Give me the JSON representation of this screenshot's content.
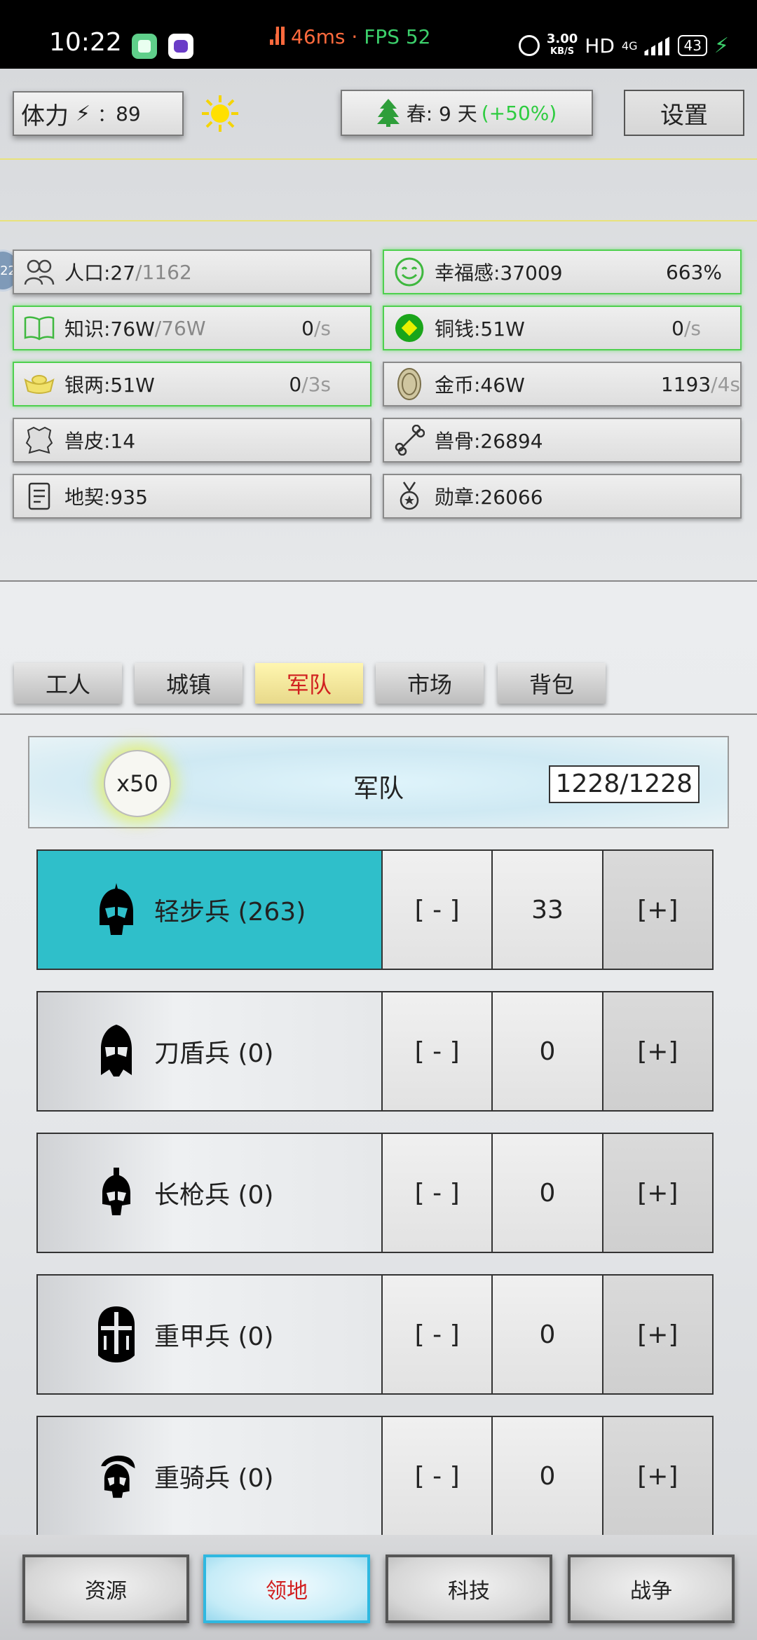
{
  "status_bar": {
    "time": "10:22",
    "ping": "46ms",
    "separator": " · ",
    "fps": "FPS 52",
    "speed_value": "3.00",
    "speed_unit": "KB/S",
    "hd": "HD",
    "network": "4G",
    "battery": "43"
  },
  "header": {
    "stamina_label": "体力",
    "stamina_sep": "：",
    "stamina_value": "89",
    "season_label": "春: 9 天",
    "season_bonus": "(+50%)",
    "settings_label": "设置"
  },
  "side_bubble": "22",
  "resources": {
    "population": {
      "label": "人口:27",
      "max": "/1162"
    },
    "happiness": {
      "label": "幸福感:37009",
      "percent": "663%"
    },
    "knowledge": {
      "label": "知识:76W",
      "max": "/76W",
      "rate": "0",
      "unit": "/s"
    },
    "copper": {
      "label": "铜钱:51W",
      "rate": "0",
      "unit": "/s"
    },
    "silver": {
      "label": "银两:51W",
      "rate": "0",
      "unit": "/3s"
    },
    "gold": {
      "label": "金币:46W",
      "rate": "1193",
      "unit": "/4s"
    },
    "pelt": {
      "label": "兽皮:14"
    },
    "bone": {
      "label": "兽骨:26894"
    },
    "deed": {
      "label": "地契:935"
    },
    "medal": {
      "label": "勋章:26066"
    }
  },
  "tabs": [
    "工人",
    "城镇",
    "军队",
    "市场",
    "背包"
  ],
  "active_tab": "军队",
  "army": {
    "multiplier": "x50",
    "title": "军队",
    "capacity": "1228/1228",
    "minus_label": "[ - ]",
    "plus_label": "[+]",
    "units": [
      {
        "name": "轻步兵 (263)",
        "value": "33"
      },
      {
        "name": "刀盾兵 (0)",
        "value": "0"
      },
      {
        "name": "长枪兵 (0)",
        "value": "0"
      },
      {
        "name": "重甲兵 (0)",
        "value": "0"
      },
      {
        "name": "重骑兵 (0)",
        "value": "0"
      }
    ]
  },
  "bottom_nav": [
    "资源",
    "领地",
    "科技",
    "战争"
  ],
  "colors": {
    "active_unit": "#2fbfca",
    "active_tab": "#fff6b0",
    "active_nav_border": "#2fb8e0",
    "positive": "#2ecc40",
    "ping": "#ff6a3d"
  }
}
